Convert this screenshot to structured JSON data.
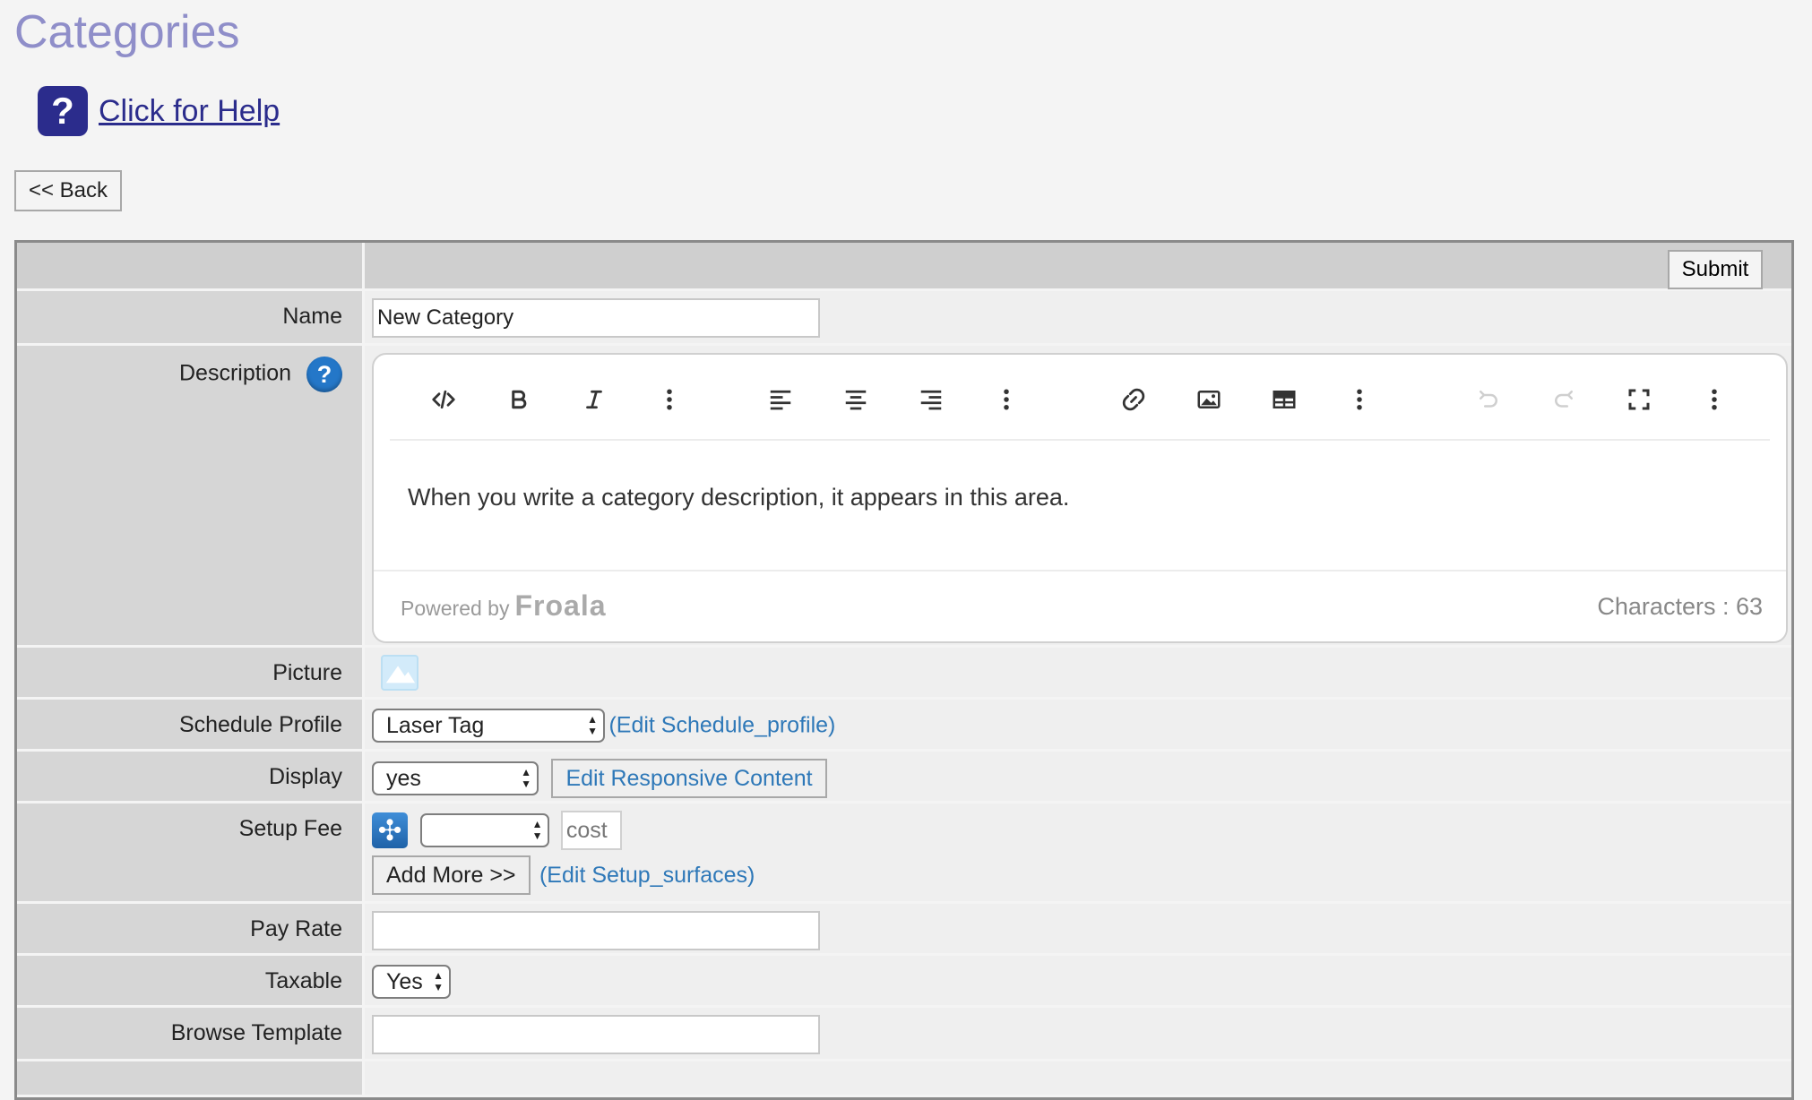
{
  "page": {
    "title": "Categories"
  },
  "help": {
    "link_text": "Click for Help",
    "icon_glyph": "?"
  },
  "nav": {
    "back_label": "<< Back"
  },
  "form": {
    "submit_label": "Submit",
    "name": {
      "label": "Name",
      "value": "New Category"
    },
    "description": {
      "label": "Description",
      "help_glyph": "?",
      "content": "When you write a category description, it appears in this area.",
      "powered_by": "Powered by",
      "brand": "Froala",
      "char_count": "Characters : 63",
      "toolbar": [
        "code-view",
        "bold",
        "italic",
        "more-text",
        "align-left",
        "align-center",
        "align-right",
        "more-paragraph",
        "link",
        "image",
        "table",
        "more-rich",
        "undo",
        "redo",
        "fullscreen",
        "more-misc"
      ]
    },
    "picture": {
      "label": "Picture"
    },
    "schedule_profile": {
      "label": "Schedule Profile",
      "selected": "Laser Tag",
      "edit_link": "(Edit Schedule_profile)"
    },
    "display": {
      "label": "Display",
      "selected": "yes",
      "edit_button": "Edit Responsive Content"
    },
    "setup_fee": {
      "label": "Setup Fee",
      "selected": "",
      "cost_placeholder": "cost",
      "add_more": "Add More >>",
      "edit_link": "(Edit Setup_surfaces)"
    },
    "pay_rate": {
      "label": "Pay Rate",
      "value": ""
    },
    "taxable": {
      "label": "Taxable",
      "selected": "Yes"
    },
    "browse_template": {
      "label": "Browse Template",
      "value": ""
    }
  },
  "colors": {
    "title": "#8f8ec9",
    "help_icon": "#2b2c8c",
    "link": "#2e78b8",
    "label_bg": "#d6d6d6"
  }
}
